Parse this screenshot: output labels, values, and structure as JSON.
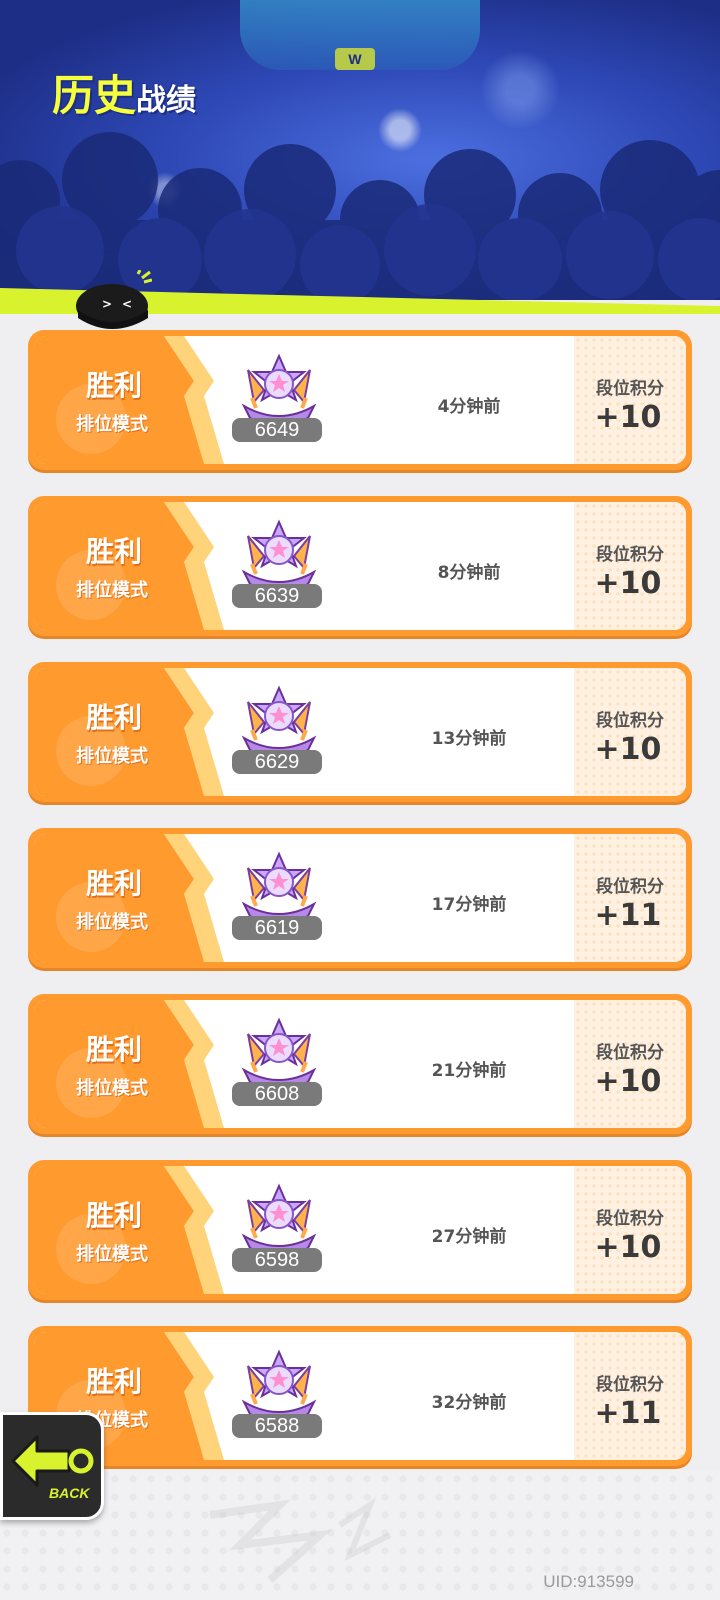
{
  "header": {
    "title_big": "历史",
    "title_small": "战绩",
    "stage_sign": "W"
  },
  "matches": [
    {
      "result": "胜利",
      "mode": "排位模式",
      "rank_score": "6649",
      "time_ago": "4分钟前",
      "points_label": "段位积分",
      "points": "+10"
    },
    {
      "result": "胜利",
      "mode": "排位模式",
      "rank_score": "6639",
      "time_ago": "8分钟前",
      "points_label": "段位积分",
      "points": "+10"
    },
    {
      "result": "胜利",
      "mode": "排位模式",
      "rank_score": "6629",
      "time_ago": "13分钟前",
      "points_label": "段位积分",
      "points": "+10"
    },
    {
      "result": "胜利",
      "mode": "排位模式",
      "rank_score": "6619",
      "time_ago": "17分钟前",
      "points_label": "段位积分",
      "points": "+11"
    },
    {
      "result": "胜利",
      "mode": "排位模式",
      "rank_score": "6608",
      "time_ago": "21分钟前",
      "points_label": "段位积分",
      "points": "+10"
    },
    {
      "result": "胜利",
      "mode": "排位模式",
      "rank_score": "6598",
      "time_ago": "27分钟前",
      "points_label": "段位积分",
      "points": "+10"
    },
    {
      "result": "胜利",
      "mode": "排位模式",
      "rank_score": "6588",
      "time_ago": "32分钟前",
      "points_label": "段位积分",
      "points": "+11"
    }
  ],
  "back_button": {
    "label": "BACK",
    "icon": "back-arrow-icon"
  },
  "footer": {
    "uid": "UID:913599"
  },
  "colors": {
    "card_orange": "#ff9a2f",
    "lime": "#d8f22e",
    "header_blue": "#2d47b4"
  }
}
